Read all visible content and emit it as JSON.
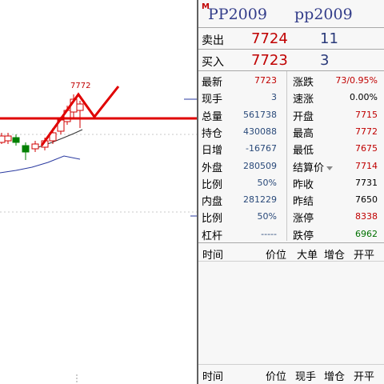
{
  "contract": {
    "marker": "M",
    "code": "PP2009",
    "code_lower": "pp2009"
  },
  "orderbook": {
    "ask_label": "卖出",
    "ask_price": "7724",
    "ask_volume": "11",
    "bid_label": "买入",
    "bid_price": "7723",
    "bid_volume": "3"
  },
  "quote_left": [
    {
      "label": "最新",
      "value": "7723",
      "color": "red"
    },
    {
      "label": "现手",
      "value": "3",
      "color": "navy"
    },
    {
      "label": "总量",
      "value": "561738",
      "color": "navy"
    },
    {
      "label": "持仓",
      "value": "430088",
      "color": "navy"
    },
    {
      "label": "日增",
      "value": "-16767",
      "color": "navy"
    },
    {
      "label": "外盘",
      "value": "280509",
      "color": "navy"
    },
    {
      "label": "比例",
      "value": "50%",
      "color": "navy"
    },
    {
      "label": "内盘",
      "value": "281229",
      "color": "navy"
    },
    {
      "label": "比例",
      "value": "50%",
      "color": "navy"
    },
    {
      "label": "杠杆",
      "value": "-----",
      "color": "navy"
    }
  ],
  "quote_right": [
    {
      "label": "涨跌",
      "value": "73/0.95%",
      "color": "red"
    },
    {
      "label": "速涨",
      "value": "0.00%",
      "color": "black"
    },
    {
      "label": "开盘",
      "value": "7715",
      "color": "red"
    },
    {
      "label": "最高",
      "value": "7772",
      "color": "red"
    },
    {
      "label": "最低",
      "value": "7675",
      "color": "red"
    },
    {
      "label": "结算价",
      "value": "7714",
      "color": "red"
    },
    {
      "label": "昨收",
      "value": "7731",
      "color": "black"
    },
    {
      "label": "昨结",
      "value": "7650",
      "color": "black"
    },
    {
      "label": "涨停",
      "value": "8338",
      "color": "red"
    },
    {
      "label": "跌停",
      "value": "6962",
      "color": "green"
    }
  ],
  "trade_headers_1": {
    "time": "时间",
    "price": "价位",
    "big": "大单",
    "add": "增仓",
    "open_close": "开平"
  },
  "trade_headers_2": {
    "time": "时间",
    "price": "价位",
    "now": "现手",
    "add": "增仓",
    "open_close": "开平"
  },
  "chart": {
    "high_label": "7772",
    "colors": {
      "up": "#d00000",
      "down": "#008000",
      "overlay": "#e00000",
      "ma": "#2a3aa0"
    }
  }
}
